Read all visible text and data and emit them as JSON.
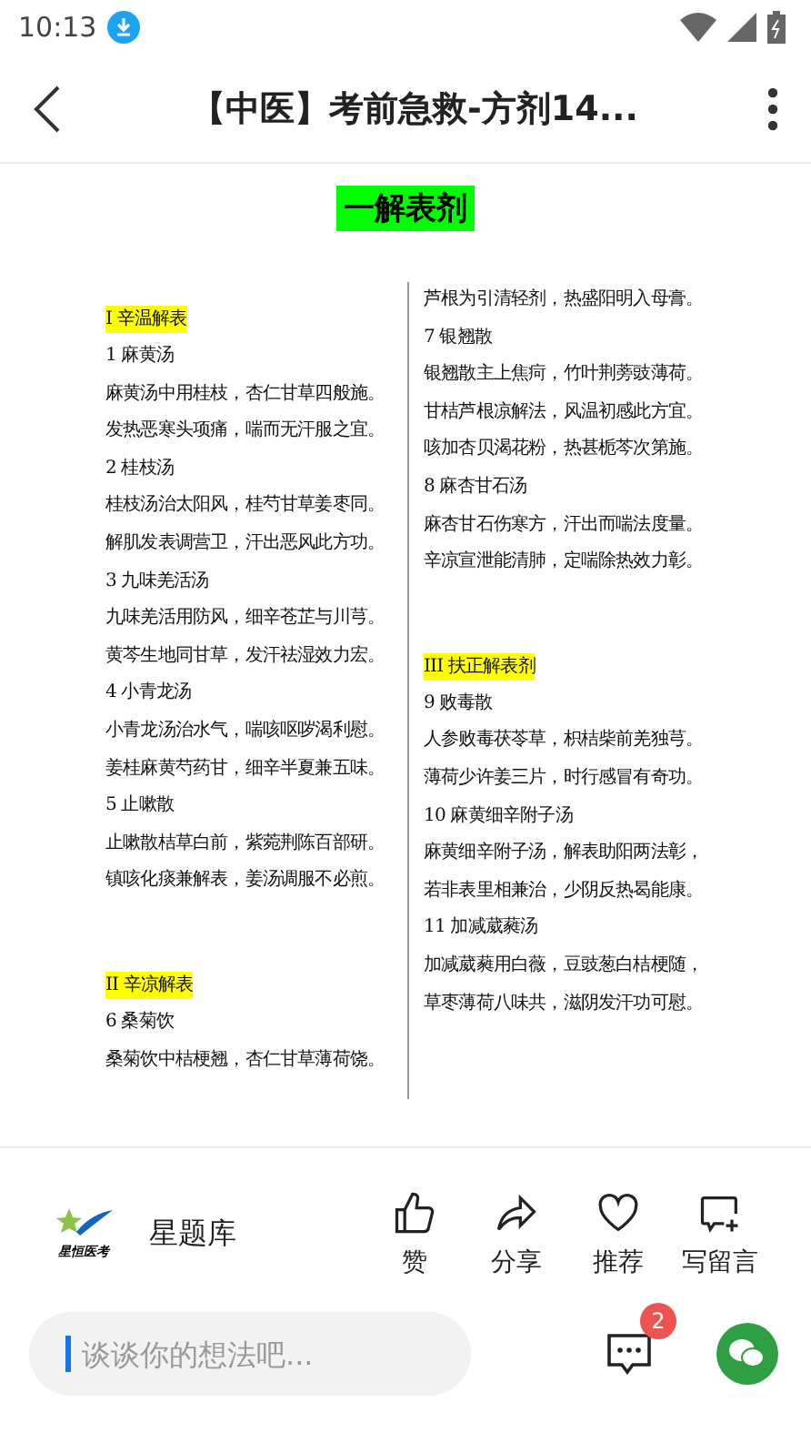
{
  "status_bar": {
    "time": "10:13"
  },
  "header": {
    "title": "【中医】考前急救-方剂14..."
  },
  "document": {
    "title": "一解表剂",
    "columns": [
      [
        {
          "kind": "heading",
          "text": "I 辛温解表"
        },
        {
          "kind": "name",
          "text": "1 麻黄汤"
        },
        {
          "kind": "verse",
          "text": "麻黄汤中用桂枝，杏仁甘草四般施。"
        },
        {
          "kind": "verse",
          "text": "发热恶寒头项痛，喘而无汗服之宜。"
        },
        {
          "kind": "name",
          "text": "2 桂枝汤"
        },
        {
          "kind": "verse",
          "text": "桂枝汤治太阳风，桂芍甘草姜枣同。"
        },
        {
          "kind": "verse",
          "text": "解肌发表调营卫，汗出恶风此方功。"
        },
        {
          "kind": "name",
          "text": "3 九味羌活汤"
        },
        {
          "kind": "verse",
          "text": "九味羌活用防风，细辛苍芷与川芎。"
        },
        {
          "kind": "verse",
          "text": "黄芩生地同甘草，发汗祛湿效力宏。"
        },
        {
          "kind": "name",
          "text": "4 小青龙汤"
        },
        {
          "kind": "verse",
          "text": "小青龙汤治水气，喘咳呕哕渴利慰。"
        },
        {
          "kind": "verse",
          "text": "姜桂麻黄芍药甘，细辛半夏兼五味。"
        },
        {
          "kind": "name",
          "text": "5 止嗽散"
        },
        {
          "kind": "verse",
          "text": "止嗽散桔草白前，紫菀荆陈百部研。"
        },
        {
          "kind": "verse",
          "text": "镇咳化痰兼解表，姜汤调服不必煎。"
        },
        {
          "kind": "gap"
        },
        {
          "kind": "heading",
          "text": "II 辛凉解表"
        },
        {
          "kind": "name",
          "text": "6 桑菊饮"
        },
        {
          "kind": "verse",
          "text": "桑菊饮中桔梗翘，杏仁甘草薄荷饶。"
        }
      ],
      [
        {
          "kind": "verse",
          "text": "芦根为引清轻剂，热盛阳明入母膏。"
        },
        {
          "kind": "name",
          "text": "7 银翘散"
        },
        {
          "kind": "verse",
          "text": "银翘散主上焦疴，竹叶荆蒡豉薄荷。"
        },
        {
          "kind": "verse",
          "text": "甘桔芦根凉解法，风温初感此方宜。"
        },
        {
          "kind": "verse",
          "text": "咳加杏贝渴花粉，热甚栀芩次第施。"
        },
        {
          "kind": "name",
          "text": "8 麻杏甘石汤"
        },
        {
          "kind": "verse",
          "text": "麻杏甘石伤寒方，汗出而喘法度量。"
        },
        {
          "kind": "verse",
          "text": "辛凉宣泄能清肺，定喘除热效力彰。"
        },
        {
          "kind": "gap"
        },
        {
          "kind": "heading",
          "text": "III 扶正解表剂"
        },
        {
          "kind": "name",
          "text": "9 败毒散"
        },
        {
          "kind": "verse",
          "text": "人参败毒茯苓草，枳桔柴前羌独芎。"
        },
        {
          "kind": "verse",
          "text": "薄荷少许姜三片，时行感冒有奇功。"
        },
        {
          "kind": "name",
          "text": "10 麻黄细辛附子汤"
        },
        {
          "kind": "verse",
          "text": "麻黄细辛附子汤，解表助阳两法彰，"
        },
        {
          "kind": "verse",
          "text": "若非表里相兼治，少阴反热曷能康。"
        },
        {
          "kind": "name",
          "text": "11 加减葳蕤汤"
        },
        {
          "kind": "verse",
          "text": "加减葳蕤用白薇，豆豉葱白桔梗随，"
        },
        {
          "kind": "verse",
          "text": "草枣薄荷八味共，滋阴发汗功可慰。"
        }
      ]
    ]
  },
  "author": {
    "logo_text": "星恒医考",
    "name": "星题库"
  },
  "actions": [
    {
      "kind": "like",
      "label": "赞"
    },
    {
      "kind": "share",
      "label": "分享"
    },
    {
      "kind": "recommend",
      "label": "推荐"
    },
    {
      "kind": "comment",
      "label": "写留言"
    }
  ],
  "comment_bar": {
    "placeholder": "谈谈你的想法吧...",
    "badge": "2"
  }
}
